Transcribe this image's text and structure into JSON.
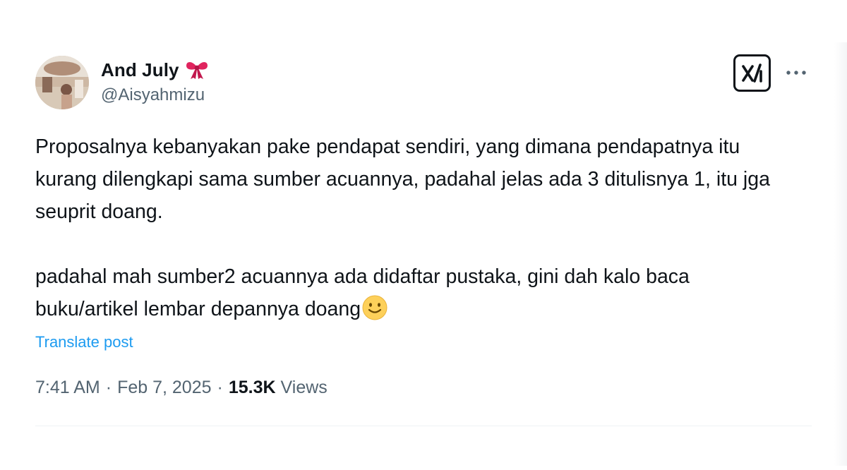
{
  "author": {
    "display_name": "And July",
    "handle": "@Aisyahmizu",
    "badge_icon": "ribbon-bow-icon"
  },
  "actions": {
    "grok_icon": "grok-icon",
    "more_icon": "more-dots-icon"
  },
  "tweet": {
    "paragraph_1": "Proposalnya kebanyakan pake pendapat sendiri, yang dimana pendapatnya itu kurang dilengkapi sama sumber acuannya, padahal jelas ada 3 ditulisnya 1, itu jga seuprit doang.",
    "paragraph_2": "padahal mah sumber2 acuannya ada didaftar pustaka, gini dah kalo baca buku/artikel lembar depannya doang",
    "trailing_emoji": "slightly-smiling-face-emoji"
  },
  "translate_label": "Translate post",
  "meta": {
    "time": "7:41 AM",
    "separator": "·",
    "date": "Feb 7, 2025",
    "views_count": "15.3K",
    "views_label": "Views"
  },
  "colors": {
    "text_primary": "#0f1419",
    "text_secondary": "#536471",
    "link": "#1d9bf0",
    "bow": "#e0245e"
  }
}
